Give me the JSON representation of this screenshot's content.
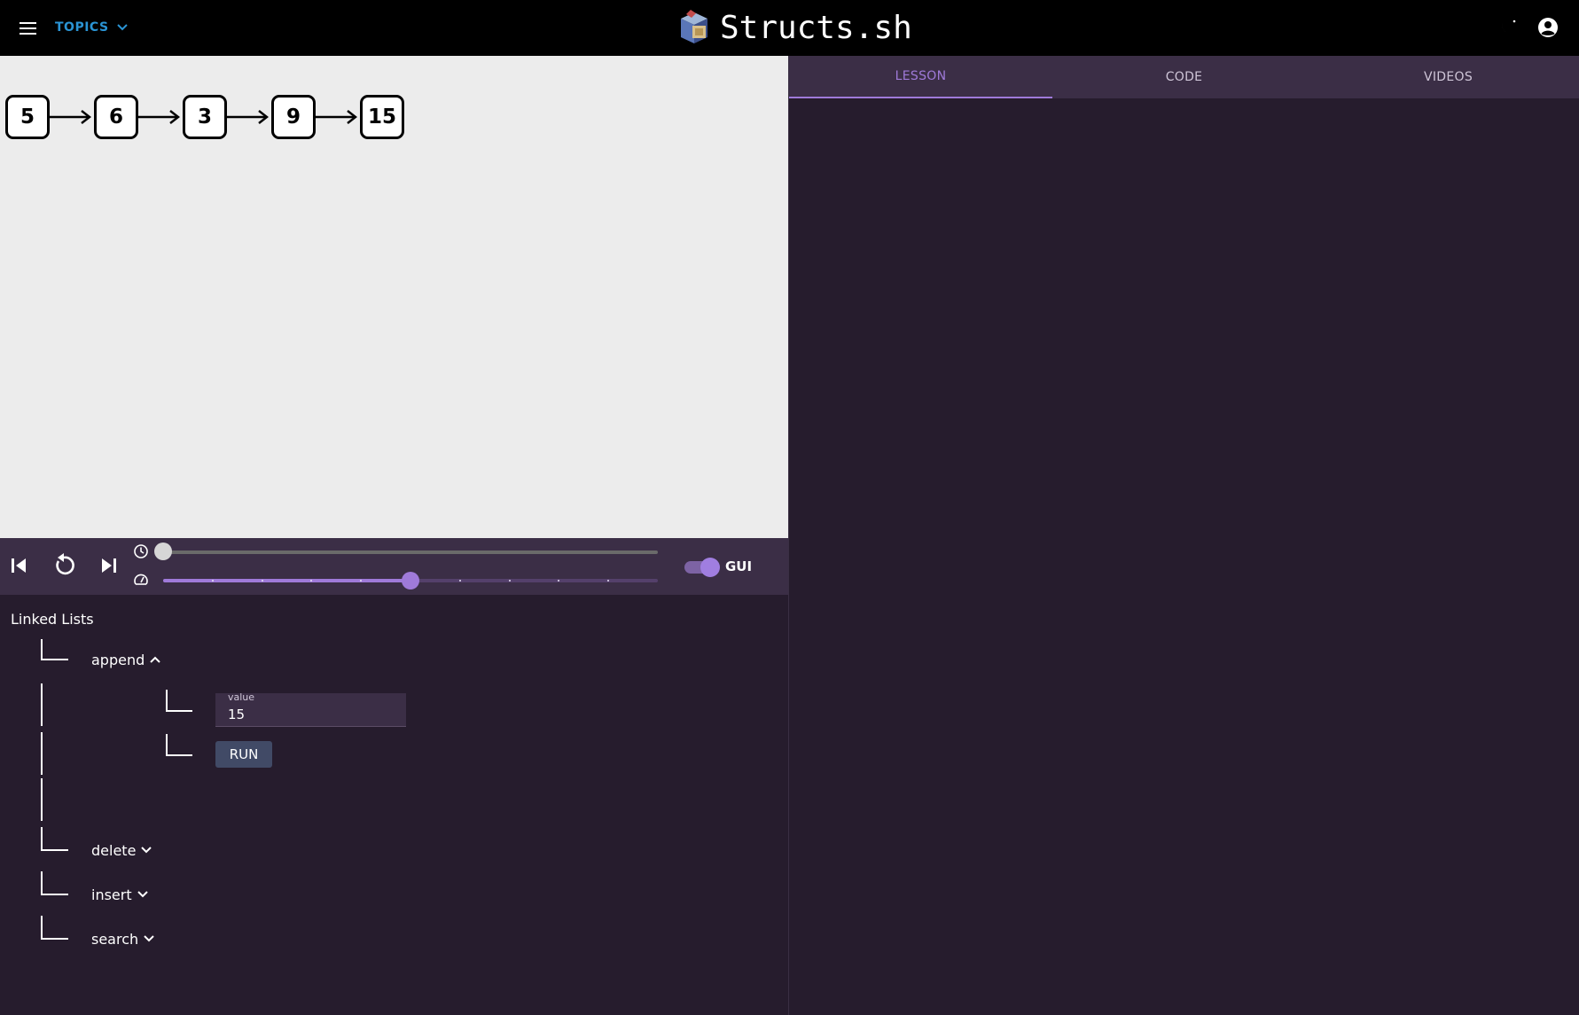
{
  "header": {
    "topics_label": "TOPICS",
    "brand_title": "Structs.sh",
    "accent_color": "#2a94d4"
  },
  "visualizer": {
    "nodes": [
      "5",
      "6",
      "3",
      "9",
      "15"
    ],
    "background": "#ececec"
  },
  "controls": {
    "timeline_progress": 0,
    "speed_fraction": 0.5,
    "gui_toggle_label": "GUI",
    "gui_toggle_on": true,
    "accent_color": "#9f7ad9"
  },
  "tree": {
    "title": "Linked Lists",
    "operations": [
      {
        "label": "append",
        "expanded": true
      },
      {
        "label": "delete",
        "expanded": false
      },
      {
        "label": "insert",
        "expanded": false
      },
      {
        "label": "search",
        "expanded": false
      }
    ],
    "append_form": {
      "field_label": "value",
      "field_value": "15",
      "run_label": "RUN"
    }
  },
  "right_panel": {
    "tabs": [
      {
        "label": "LESSON",
        "active": true
      },
      {
        "label": "CODE",
        "active": false
      },
      {
        "label": "VIDEOS",
        "active": false
      }
    ]
  }
}
